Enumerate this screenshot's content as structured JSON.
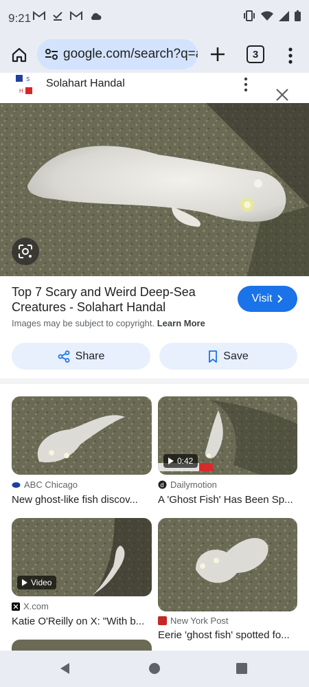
{
  "status": {
    "time": "9:21"
  },
  "browser": {
    "url": "google.com/search?q=a",
    "tab_count": "3"
  },
  "panel": {
    "site_name": "Solahart Handal",
    "logo_letters": [
      "S",
      "H"
    ],
    "title": "Top 7 Scary and Weird Deep-Sea Creatures - Solahart Handal",
    "visit_label": "Visit",
    "copyright_text": "Images may be subject to copyright.",
    "learn_more": "Learn More",
    "share_label": "Share",
    "save_label": "Save"
  },
  "results": [
    {
      "source": "ABC Chicago",
      "title": "New ghost-like fish discov...",
      "badge": ""
    },
    {
      "source": "Dailymotion",
      "title": "A 'Ghost Fish' Has Been Sp...",
      "badge": "0:42"
    },
    {
      "source": "X.com",
      "title": "Katie O'Reilly on X: \"With b...",
      "badge": "Video"
    },
    {
      "source": "New York Post",
      "title": "Eerie 'ghost fish' spotted fo...",
      "badge": ""
    }
  ],
  "colors": {
    "accent": "#1a73e8",
    "chrome_bg": "#e9edf3",
    "omnibox": "#d3e3fd",
    "chip": "#e8f0fe"
  }
}
